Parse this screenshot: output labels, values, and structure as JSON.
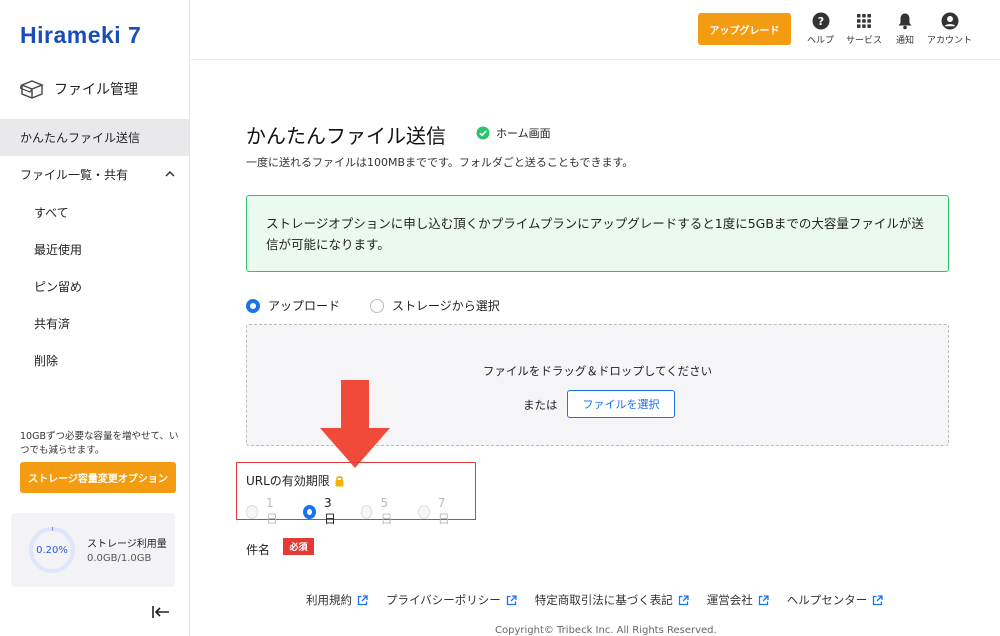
{
  "brand": {
    "logo_text": "Hirameki 7"
  },
  "sidebar": {
    "section_title": "ファイル管理",
    "items": [
      {
        "label": "かんたんファイル送信"
      },
      {
        "label": "ファイル一覧・共有"
      },
      {
        "label": "すべて"
      },
      {
        "label": "最近使用"
      },
      {
        "label": "ピン留め"
      },
      {
        "label": "共有済"
      },
      {
        "label": "削除"
      }
    ],
    "promo_text": "10GBずつ必要な容量を増やせて、いつでも減らせます。",
    "promo_button": "ストレージ容量変更オプション",
    "storage": {
      "percent_label": "0.20%",
      "percent_value": 0.2,
      "label": "ストレージ利用量",
      "value": "0.0GB/1.0GB"
    }
  },
  "header": {
    "upgrade_button": "アップグレード",
    "icons": [
      {
        "name": "help-icon",
        "label": "ヘルプ"
      },
      {
        "name": "grid-icon",
        "label": "サービス"
      },
      {
        "name": "bell-icon",
        "label": "通知"
      },
      {
        "name": "account-icon",
        "label": "アカウント"
      }
    ]
  },
  "main": {
    "title": "かんたんファイル送信",
    "home_badge": "ホーム画面",
    "subtitle": "一度に送れるファイルは100MBまでです。フォルダごと送ることもできます。",
    "notice": "ストレージオプションに申し込む頂くかプライムプランにアップグレードすると1度に5GBまでの大容量ファイルが送信が可能になります。",
    "source_options": [
      {
        "label": "アップロード",
        "selected": true
      },
      {
        "label": "ストレージから選択",
        "selected": false
      }
    ],
    "dropzone_text": "ファイルをドラッグ＆ドロップしてください",
    "or_text": "または",
    "choose_button": "ファイルを選択",
    "url_expiry": {
      "label": "URLの有効期限",
      "options": [
        {
          "label": "1日",
          "selected": false,
          "disabled": true
        },
        {
          "label": "3日",
          "selected": true,
          "disabled": false
        },
        {
          "label": "5日",
          "selected": false,
          "disabled": true
        },
        {
          "label": "7日",
          "selected": false,
          "disabled": true
        }
      ]
    },
    "subject_label": "件名",
    "required_badge": "必須"
  },
  "footer": {
    "links": [
      "利用規約",
      "プライバシーポリシー",
      "特定商取引法に基づく表記",
      "運営会社",
      "ヘルプセンター"
    ],
    "copyright": "Copyright© Tribeck Inc. All Rights Reserved."
  },
  "colors": {
    "accent": "#f39c12",
    "primary": "#1a73e8",
    "success": "#2ec36a",
    "danger": "#e53935",
    "brand": "#1a4db8"
  }
}
